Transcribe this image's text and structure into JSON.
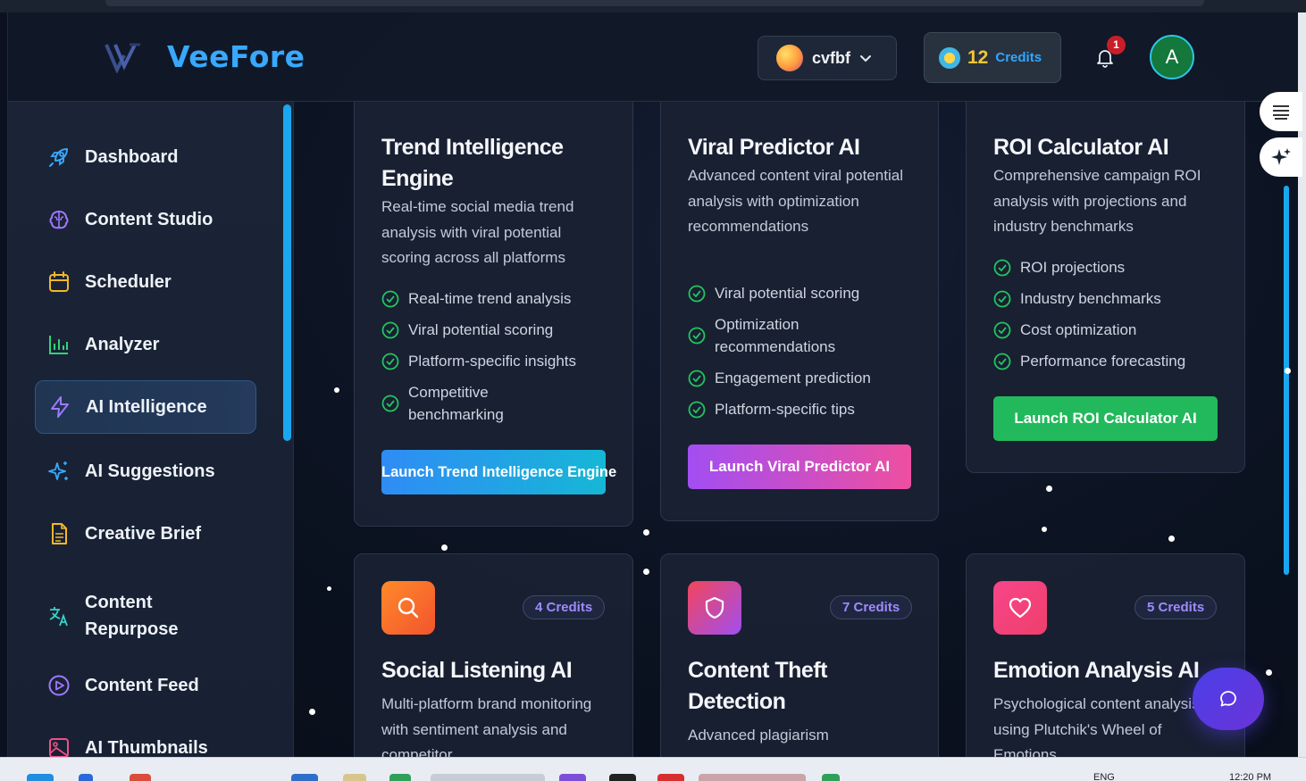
{
  "app": {
    "brand": "VeeFore"
  },
  "header": {
    "workspace": "cvfbf",
    "credits_count": "12",
    "credits_label": "Credits",
    "notifications_count": "1",
    "avatar_initial": "A"
  },
  "sidebar": {
    "items": [
      {
        "label": "Dashboard",
        "icon": "rocket-icon",
        "color": "#38a9ff",
        "active": false
      },
      {
        "label": "Content Studio",
        "icon": "brain-icon",
        "color": "#a078ff",
        "active": false
      },
      {
        "label": "Scheduler",
        "icon": "calendar-icon",
        "color": "#f5b729",
        "active": false
      },
      {
        "label": "Analyzer",
        "icon": "bar-chart-icon",
        "color": "#34d27a",
        "active": false
      },
      {
        "label": "AI Intelligence",
        "icon": "lightning-icon",
        "color": "#a078ff",
        "active": true
      },
      {
        "label": "AI Suggestions",
        "icon": "sparkles-icon",
        "color": "#38a9ff",
        "active": false
      },
      {
        "label": "Creative Brief",
        "icon": "document-icon",
        "color": "#f5b729",
        "active": false
      },
      {
        "label": "Content\nRepurpose",
        "icon": "translate-icon",
        "color": "#38d3c8",
        "active": false
      },
      {
        "label": "Content Feed",
        "icon": "play-circle-icon",
        "color": "#a078ff",
        "active": false
      },
      {
        "label": "AI Thumbnails",
        "icon": "image-icon",
        "color": "#ef4f8a",
        "active": false
      }
    ]
  },
  "cards_top": [
    {
      "title": "Trend Intelligence Engine",
      "description": "Real-time social media trend analysis with viral potential scoring across all platforms",
      "features": [
        "Real-time trend analysis",
        "Viral potential scoring",
        "Platform-specific insights",
        "Competitive benchmarking"
      ],
      "button": "Launch Trend Intelligence Engine",
      "accent": "#2f8cf5"
    },
    {
      "title": "Viral Predictor AI",
      "description": "Advanced content viral potential analysis with optimization recommendations",
      "features": [
        "Viral potential scoring",
        "Optimization recommendations",
        "Engagement prediction",
        "Platform-specific tips"
      ],
      "button": "Launch Viral Predictor AI",
      "accent": "#b44ef0"
    },
    {
      "title": "ROI Calculator AI",
      "description": "Comprehensive campaign ROI analysis with projections and industry benchmarks",
      "features": [
        "ROI projections",
        "Industry benchmarks",
        "Cost optimization",
        "Performance forecasting"
      ],
      "button": "Launch ROI Calculator AI",
      "accent": "#22b95c"
    }
  ],
  "cards_bottom": [
    {
      "title": "Social Listening AI",
      "credits": "4 Credits",
      "description": "Multi-platform brand monitoring with sentiment analysis and competitor",
      "icon": "search-icon"
    },
    {
      "title": "Content Theft Detection",
      "credits": "7 Credits",
      "description": "Advanced plagiarism",
      "icon": "shield-icon"
    },
    {
      "title": "Emotion Analysis AI",
      "credits": "5 Credits",
      "description": "Psychological content analysis using Plutchik's Wheel of Emotions",
      "icon": "heart-icon"
    }
  ],
  "taskbar": {
    "lang": "ENG",
    "time": "12:20 PM"
  }
}
